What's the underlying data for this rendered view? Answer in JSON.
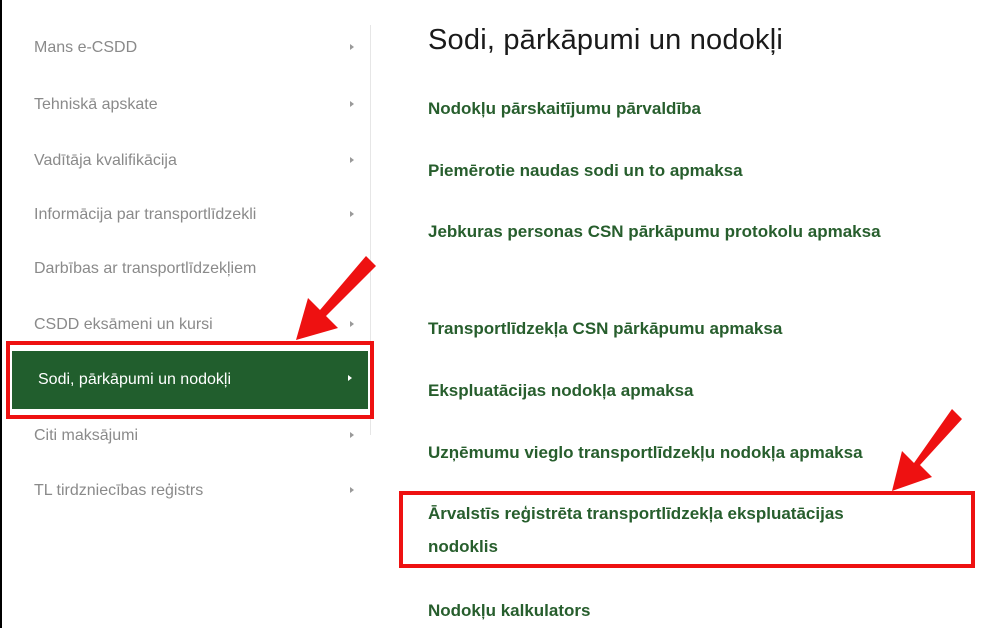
{
  "sidebar": {
    "items": [
      {
        "label": "Mans e-CSDD"
      },
      {
        "label": "Tehniskā apskate"
      },
      {
        "label": "Vadītāja kvalifikācija"
      },
      {
        "label": "Informācija par transportlīdzekli"
      },
      {
        "label": "Darbības ar transportlīdzekļiem"
      },
      {
        "label": "CSDD eksāmeni un kursi"
      },
      {
        "label": "Sodi, pārkāpumi un nodokļi"
      },
      {
        "label": "Citi maksājumi"
      },
      {
        "label": "TL tirdzniecības reģistrs"
      }
    ],
    "active_color": "#215e2d"
  },
  "main": {
    "title": "Sodi, pārkāpumi un nodokļi",
    "links": [
      {
        "label": "Nodokļu pārskaitījumu pārvaldība"
      },
      {
        "label": "Piemērotie naudas sodi un to apmaksa"
      },
      {
        "label": "Jebkuras personas CSN pārkāpumu protokolu apmaksa"
      },
      {
        "label": "Transportlīdzekļa CSN pārkāpumu apmaksa"
      },
      {
        "label": "Ekspluatācijas nodokļa apmaksa"
      },
      {
        "label": "Uzņēmumu vieglo transportlīdzekļu nodokļa apmaksa"
      },
      {
        "label": "Ārvalstīs reģistrēta transportlīdzekļa ekspluatācijas nodoklis"
      },
      {
        "label": "Nodokļu kalkulators"
      }
    ],
    "link_color": "#275e2d"
  },
  "annotation": {
    "highlight_color": "#ee1111"
  }
}
